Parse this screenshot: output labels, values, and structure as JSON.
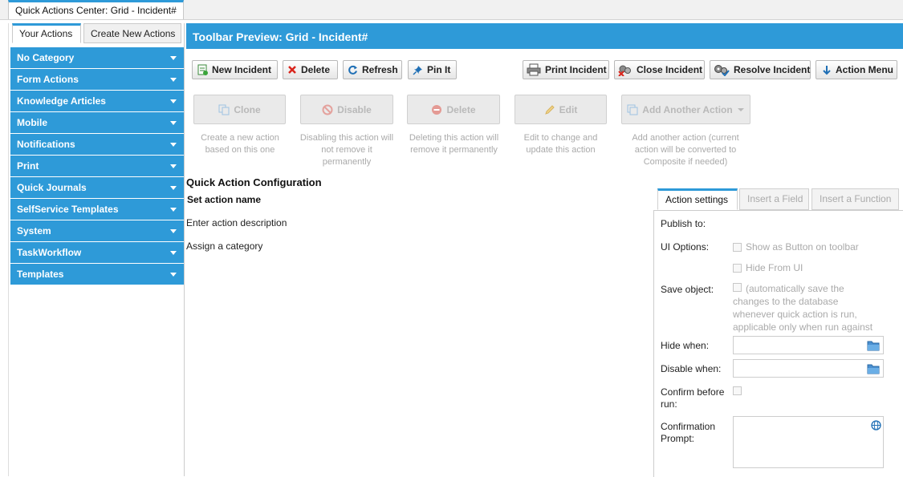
{
  "window": {
    "tab_title": "Quick Actions Center: Grid - Incident#"
  },
  "left": {
    "tabs": [
      "Your Actions",
      "Create New Actions"
    ],
    "categories": [
      "No Category",
      "Form Actions",
      "Knowledge Articles",
      "Mobile",
      "Notifications",
      "Print",
      "Quick Journals",
      "SelfService Templates",
      "System",
      "TaskWorkflow",
      "Templates"
    ]
  },
  "main": {
    "header": "Toolbar Preview: Grid - Incident#"
  },
  "toolbar": {
    "new_incident": "New Incident",
    "delete": "Delete",
    "refresh": "Refresh",
    "pin_it": "Pin It",
    "print_incident": "Print Incident",
    "close_incident": "Close Incident",
    "resolve_incident": "Resolve Incident",
    "action_menu": "Action Menu"
  },
  "actions": {
    "clone": {
      "label": "Clone",
      "desc": "Create a new action based on this one"
    },
    "disable": {
      "label": "Disable",
      "desc": "Disabling this action will not remove it permanently"
    },
    "delete": {
      "label": "Delete",
      "desc": "Deleting this action will remove it permanently"
    },
    "edit": {
      "label": "Edit",
      "desc": "Edit to change and update this action"
    },
    "add_another": {
      "label": "Add Another Action",
      "desc": "Add another action (current action will be converted to Composite if needed)"
    }
  },
  "config": {
    "title": "Quick Action Configuration",
    "name": "Set action name",
    "description": "Enter action description",
    "category": "Assign a category"
  },
  "settings": {
    "tabs": [
      "Action settings",
      "Insert a Field",
      "Insert a Function"
    ],
    "publish_to": "Publish to:",
    "ui_options": "UI Options:",
    "show_as_button": "Show as Button on toolbar",
    "hide_from_ui": "Hide From UI",
    "save_object": "Save object:",
    "save_object_note": "(automatically save the changes to the database whenever quick action is run, applicable only when run against the form)",
    "hide_when": "Hide when:",
    "disable_when": "Disable when:",
    "confirm_before_run": "Confirm before run:",
    "confirmation_prompt": "Confirmation Prompt:"
  },
  "colors": {
    "accent": "#2e9ad8"
  }
}
